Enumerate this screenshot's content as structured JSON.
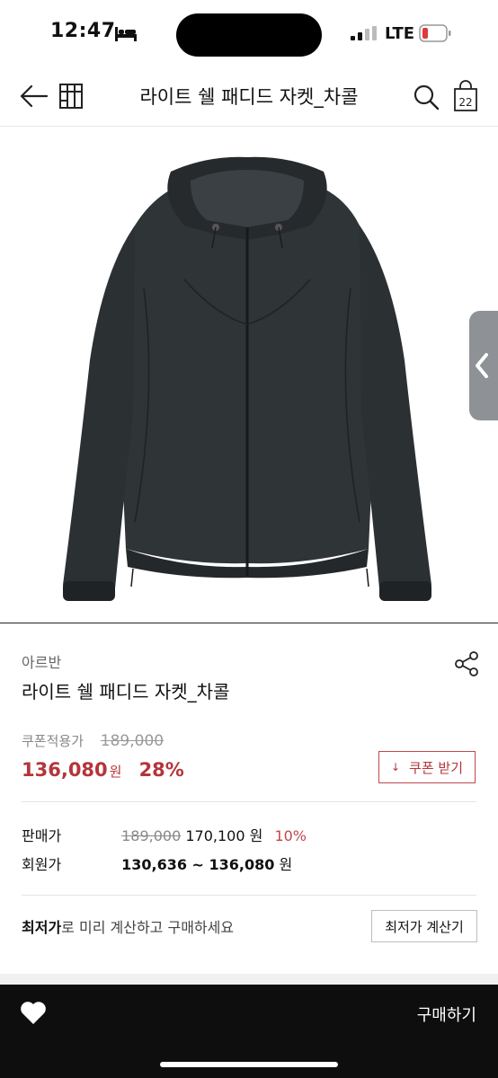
{
  "status": {
    "time": "12:47",
    "network": "LTE"
  },
  "nav": {
    "title": "라이트 쉘 패디드 자켓_차콜",
    "cart_count": "22"
  },
  "product": {
    "brand": "아르반",
    "name": "라이트 쉘 패디드 자켓_차콜",
    "coupon_label": "쿠폰적용가",
    "original_price": "189,000",
    "final_price": "136,080",
    "final_price_unit": "원",
    "discount_rate": "28%",
    "coupon_button": "쿠폰 받기"
  },
  "price_table": {
    "sale_label": "판매가",
    "sale_original": "189,000",
    "sale_price": "170,100 원",
    "sale_rate": "10%",
    "member_label": "회원가",
    "member_range": "130,636 ~ 136,080",
    "member_unit": "원"
  },
  "lowest": {
    "strong": "최저가",
    "rest": "로 미리 계산하고 구매하세요",
    "button": "최저가 계산기"
  },
  "bottom": {
    "buy_label": "구매하기"
  },
  "colors": {
    "accent": "#b5353a",
    "jacket": "#2f3436",
    "bar": "#0e0e0e"
  }
}
